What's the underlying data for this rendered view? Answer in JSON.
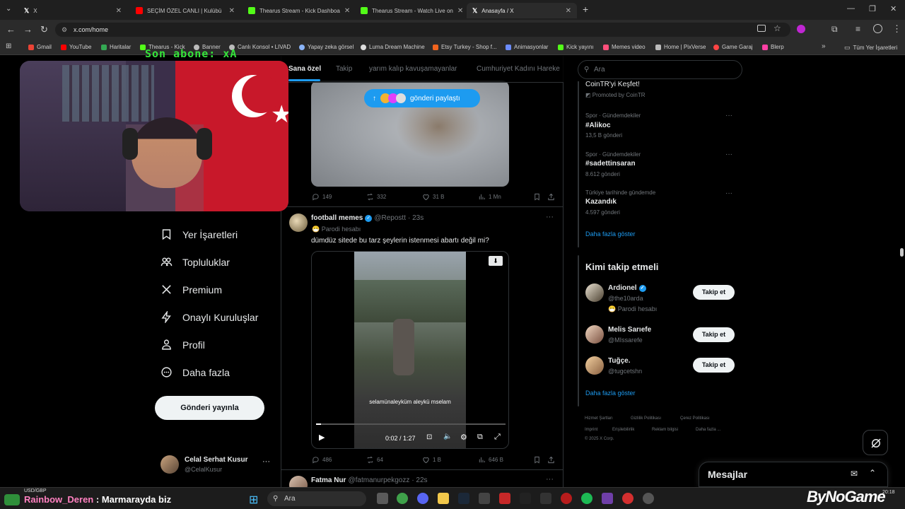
{
  "browser": {
    "tabs": [
      {
        "title": "X",
        "color": "#ffffff"
      },
      {
        "title": "SEÇİM ÖZEL CANLI | Kulübü",
        "color": "#ff0000"
      },
      {
        "title": "Thearus Stream - Kick Dashboa",
        "color": "#53fc18"
      },
      {
        "title": "Thearus Stream - Watch Live on",
        "color": "#53fc18"
      },
      {
        "title": "Anasayfa / X",
        "color": "#ffffff"
      }
    ],
    "url": "x.com/home",
    "bookmarks": [
      {
        "label": "Gmail",
        "color": "#ea4335"
      },
      {
        "label": "YouTube",
        "color": "#ff0000"
      },
      {
        "label": "Haritalar",
        "color": "#34a853"
      },
      {
        "label": "Thearus - Kick",
        "color": "#53fc18"
      },
      {
        "label": "Banner",
        "color": "#bbbbbb"
      },
      {
        "label": "Canlı Konsol • LIVAD",
        "color": "#bbbbbb"
      },
      {
        "label": "Yapay zeka görsel",
        "color": "#8ab4f8"
      },
      {
        "label": "Luma Dream Machine",
        "color": "#dddddd"
      },
      {
        "label": "Etsy Turkey - Shop f...",
        "color": "#f1641e"
      },
      {
        "label": "Animasyonlar",
        "color": "#6b8cff"
      },
      {
        "label": "Kick yayını",
        "color": "#53fc18"
      },
      {
        "label": "Memes video",
        "color": "#ff4f7b"
      },
      {
        "label": "Home | PixVerse",
        "color": "#bbbbbb"
      },
      {
        "label": "Game Garaj",
        "color": "#ff4444"
      },
      {
        "label": "Blerp",
        "color": "#ff3fa4"
      }
    ],
    "all_bookmarks": "Tüm Yer İşaretleri"
  },
  "overlay": {
    "sub_text": "Son abone: xA",
    "chat_user": "Rainbow_Deren",
    "chat_msg": ": Marmarayda biz",
    "ticker": "USD/GBP",
    "brand": "ByNoGame"
  },
  "sidebar": {
    "items": [
      {
        "label": "Yer İşaretleri",
        "icon": "bookmark-icon"
      },
      {
        "label": "Topluluklar",
        "icon": "communities-icon"
      },
      {
        "label": "Premium",
        "icon": "x-premium-icon"
      },
      {
        "label": "Onaylı Kuruluşlar",
        "icon": "lightning-icon"
      },
      {
        "label": "Profil",
        "icon": "profile-icon"
      },
      {
        "label": "Daha fazla",
        "icon": "more-circle-icon"
      }
    ],
    "post_button": "Gönderi yayınla",
    "account": {
      "name": "Celal Serhat Kusur",
      "handle": "@CelalKusur"
    }
  },
  "feed": {
    "tabs": [
      "Sana özel",
      "Takip",
      "yarım kalıp kavuşamayanlar",
      "Cumhuriyet Kadını Hareke"
    ],
    "pill_text": "gönderi paylaştı",
    "post1_stats": {
      "replies": "149",
      "reposts": "332",
      "likes": "31 B",
      "views": "1 Mn"
    },
    "post2": {
      "name": "football memes",
      "handle": "@Repostt",
      "time": "· 23s",
      "badge": "Parodi hesabı",
      "text": "dümdüz sitede bu tarz şeylerin istenmesi abartı değil mi?",
      "subtitle": "selamünaleyküm aleykü mselam",
      "video_time": "0:02 / 1:27",
      "progress": 0.025,
      "stats": {
        "replies": "486",
        "reposts": "64",
        "likes": "1 B",
        "views": "646 B"
      }
    },
    "post3": {
      "name": "Fatma Nur",
      "handle": "@fatmanurpekgozz",
      "time": "· 22s"
    }
  },
  "right": {
    "search_placeholder": "Ara",
    "promo": {
      "title": "CoinTR'yi Keşfet!",
      "by": "Promoted by CoinTR"
    },
    "trends": [
      {
        "category": "Spor · Gündemdekiler",
        "name": "#Alikoc",
        "count": "13,5 B gönderi"
      },
      {
        "category": "Spor · Gündemdekiler",
        "name": "#sadettinsaran",
        "count": "8.612 gönderi"
      },
      {
        "category": "Türkiye tarihinde gündemde",
        "name": "Kazandık",
        "count": "4.597 gönderi"
      }
    ],
    "show_more": "Daha fazla göster",
    "who_to_follow_title": "Kimi takip etmeli",
    "suggestions": [
      {
        "name": "Ardionel",
        "handle": "@the10arda",
        "note": "Parodi hesabı",
        "verified": true
      },
      {
        "name": "Melis Sarıefe",
        "handle": "@MIssarefe",
        "note": "",
        "verified": false
      },
      {
        "name": "Tuğçe.",
        "handle": "@tugcetshn",
        "note": "",
        "verified": false
      }
    ],
    "follow_label": "Takip et",
    "footer": [
      "Hizmet Şartları",
      "Gizlilik Politikası",
      "Çerez Politikası",
      "Imprint",
      "Erişilebilirlik",
      "Reklam bilgisi",
      "Daha fazla ...",
      "© 2025 X Corp."
    ],
    "messages_label": "Mesajlar"
  },
  "taskbar": {
    "search": "Ara",
    "time": "20:18"
  }
}
